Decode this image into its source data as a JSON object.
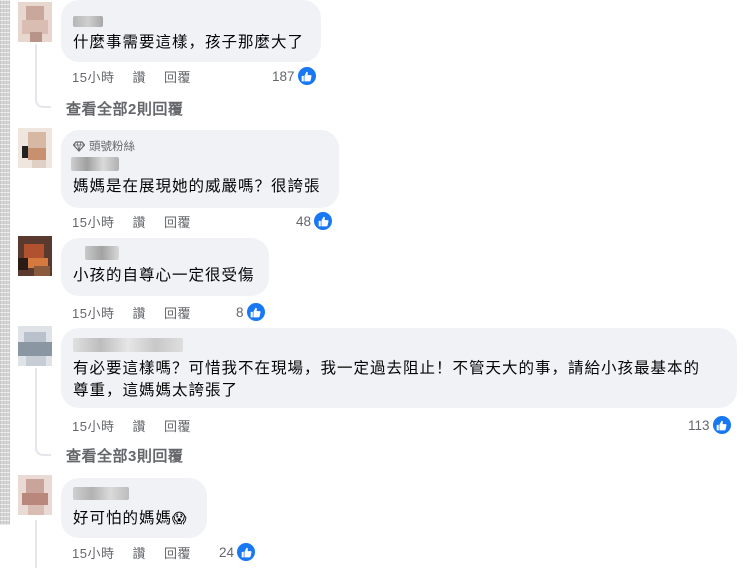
{
  "comments": [
    {
      "text": "什麼事需要這樣，孩子那麼大了",
      "time": "15小時",
      "like_label": "讚",
      "reply_label": "回覆",
      "reactions": "187"
    },
    {
      "badge": "頭號粉絲",
      "text": "媽媽是在展現她的威嚴嗎？很誇張",
      "time": "15小時",
      "like_label": "讚",
      "reply_label": "回覆",
      "reactions": "48"
    },
    {
      "text": "小孩的自尊心一定很受傷",
      "time": "15小時",
      "like_label": "讚",
      "reply_label": "回覆",
      "reactions": "8"
    },
    {
      "text_line1": "有必要這樣嗎？可惜我不在現場，我一定過去阻止！不管天大的事，請給小孩最基本的",
      "text_line2": "尊重，這媽媽太誇張了",
      "time": "15小時",
      "like_label": "讚",
      "reply_label": "回覆",
      "reactions": "113"
    },
    {
      "text": "好可怕的媽媽",
      "emoji": "😱",
      "time": "15小時",
      "like_label": "讚",
      "reply_label": "回覆",
      "reactions": "24"
    }
  ],
  "view_replies": [
    "查看全部2則回覆",
    "查看全部3則回覆"
  ],
  "icons": {
    "like": "thumbs-up-icon",
    "badge": "diamond-icon",
    "emoji": "fearful-face-emoji"
  },
  "colors": {
    "like_blue": "#1877f2",
    "bubble": "#f0f2f5",
    "muted": "#65676b"
  }
}
